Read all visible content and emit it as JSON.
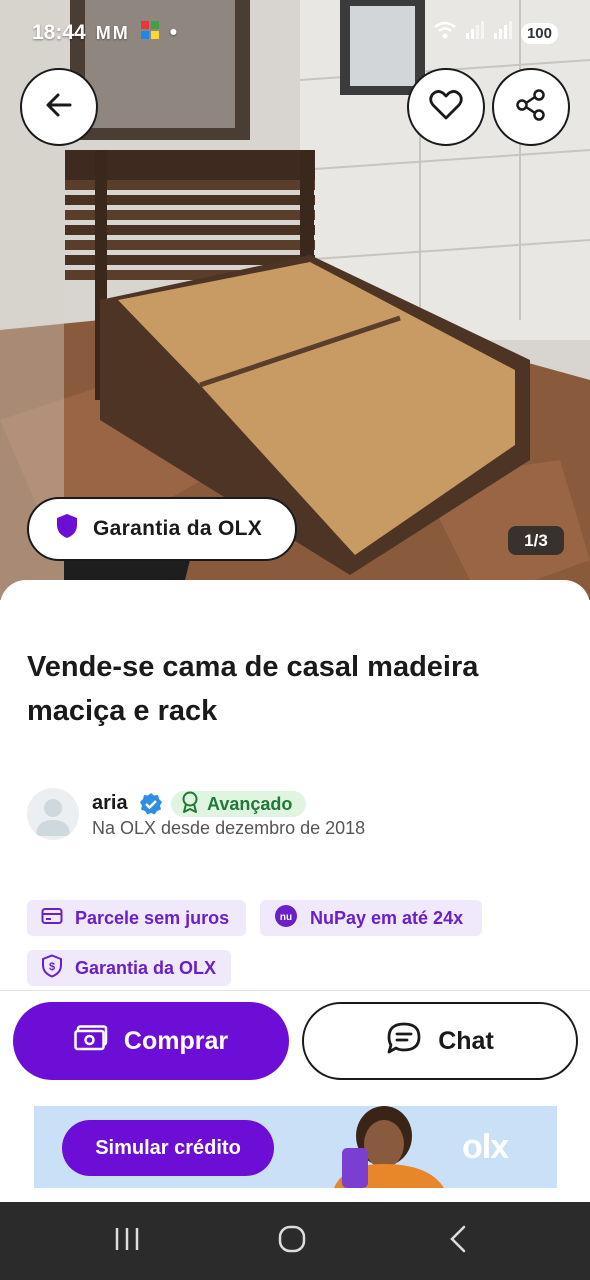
{
  "status_bar": {
    "time": "18:44",
    "notification_icons": "MM",
    "battery": "100"
  },
  "listing": {
    "title": "Vende-se cama de casal madeira maciça e rack",
    "guarantee_pill": "Garantia da OLX",
    "image_counter": "1/3"
  },
  "seller": {
    "name": "aria",
    "level": "Avançado",
    "since": "Na OLX desde dezembro de 2018"
  },
  "chips": {
    "parcele": "Parcele sem juros",
    "nupay": "NuPay em até 24x",
    "garantia": "Garantia da OLX"
  },
  "actions": {
    "buy_label": "Comprar",
    "chat_label": "Chat"
  },
  "banner": {
    "button_label": "Simular crédito",
    "logo": "olx"
  },
  "colors": {
    "brand_purple": "#6c0ed6",
    "badge_green": "#1e7a35",
    "chip_bg": "#f0e8fb"
  },
  "icons": {
    "back": "arrow-left-icon",
    "favorite": "heart-icon",
    "share": "share-icon",
    "shield": "shield-icon",
    "verified": "verified-check-icon",
    "medal": "medal-icon",
    "card": "credit-card-icon",
    "nupay": "nupay-logo-icon",
    "shield_dollar": "shield-dollar-icon",
    "money": "money-icon",
    "chat": "chat-bubble-icon"
  }
}
